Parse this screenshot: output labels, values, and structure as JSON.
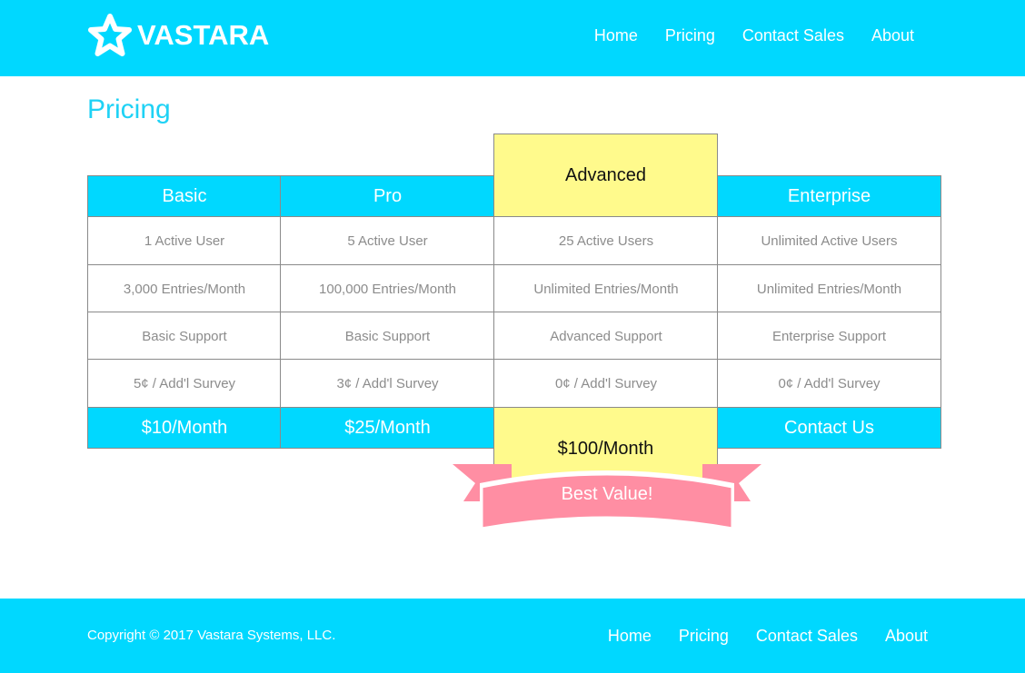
{
  "brand": {
    "name": "VASTARA",
    "logo_icon": "star-icon"
  },
  "header_nav": [
    "Home",
    "Pricing",
    "Contact Sales",
    "About"
  ],
  "page_title": "Pricing",
  "plans": [
    {
      "name": "Basic",
      "features": [
        "1 Active User",
        "3,000 Entries/Month",
        "Basic Support",
        "5¢ / Add'l Survey"
      ],
      "price": "$10/Month"
    },
    {
      "name": "Pro",
      "features": [
        "5 Active User",
        "100,000 Entries/Month",
        "Basic Support",
        "3¢ / Add'l Survey"
      ],
      "price": "$25/Month"
    },
    {
      "name": "Advanced",
      "features": [
        "25 Active Users",
        "Unlimited Entries/Month",
        "Advanced Support",
        "0¢ / Add'l Survey"
      ],
      "price": "$100/Month",
      "ribbon": "Best Value!"
    },
    {
      "name": "Enterprise",
      "features": [
        "Unlimited Active Users",
        "Unlimited Entries/Month",
        "Enterprise Support",
        "0¢ / Add'l Survey"
      ],
      "price": "Contact Us"
    }
  ],
  "footer": {
    "copyright": "Copyright © 2017 Vastara Systems, LLC.",
    "nav": [
      "Home",
      "Pricing",
      "Contact Sales",
      "About"
    ]
  },
  "colors": {
    "accent": "#00d8ff",
    "featured": "#fffa8c",
    "ribbon": "#ff8ea3",
    "cell_text": "#8c8c8c"
  }
}
